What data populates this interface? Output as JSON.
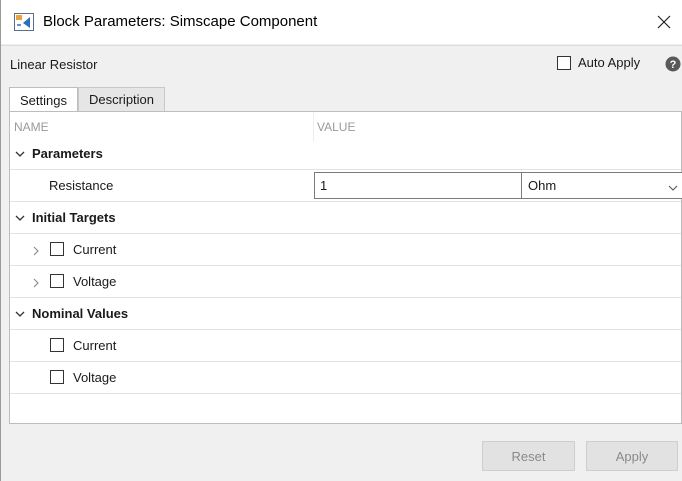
{
  "window": {
    "title": "Block Parameters: Simscape Component"
  },
  "header": {
    "block_name": "Linear Resistor",
    "auto_apply_label": "Auto Apply",
    "auto_apply_checked": false
  },
  "tabs": [
    {
      "label": "Settings",
      "active": true
    },
    {
      "label": "Description",
      "active": false
    }
  ],
  "columns": {
    "name": "NAME",
    "value": "VALUE"
  },
  "sections": [
    {
      "label": "Parameters",
      "expanded": true,
      "rows": [
        {
          "label": "Resistance",
          "value": "1",
          "unit": "Ohm"
        }
      ]
    },
    {
      "label": "Initial Targets",
      "expanded": true,
      "rows": [
        {
          "label": "Current",
          "checked": false,
          "expandable": true
        },
        {
          "label": "Voltage",
          "checked": false,
          "expandable": true
        }
      ]
    },
    {
      "label": "Nominal Values",
      "expanded": true,
      "rows": [
        {
          "label": "Current",
          "checked": false
        },
        {
          "label": "Voltage",
          "checked": false
        }
      ]
    }
  ],
  "footer": {
    "reset_label": "Reset",
    "apply_label": "Apply"
  },
  "colors": {
    "window_bg": "#f0f0f0",
    "panel_bg": "#ffffff",
    "disabled_text": "#8a8a8a",
    "help_icon": "#595959"
  },
  "icons": {
    "app": "simulink-block-icon",
    "close": "close-icon",
    "help": "help-icon",
    "section_toggle": "chevron-down-icon",
    "row_expander": "chevron-right-icon",
    "dropdown": "chevron-down-icon"
  }
}
